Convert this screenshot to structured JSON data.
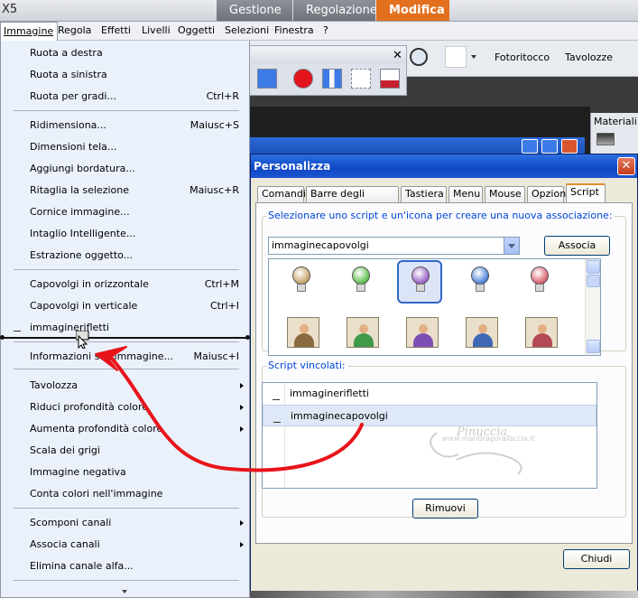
{
  "window": {
    "title_fragment": "X5"
  },
  "top_tabs": [
    {
      "label": "Gestione"
    },
    {
      "label": "Regolazione"
    },
    {
      "label": "Modifica",
      "active": true
    }
  ],
  "menubar": [
    {
      "label": "Immagine"
    },
    {
      "label": "Regola"
    },
    {
      "label": "Effetti"
    },
    {
      "label": "Livelli"
    },
    {
      "label": "Oggetti"
    },
    {
      "label": "Selezioni"
    },
    {
      "label": "Finestra"
    },
    {
      "label": "?"
    }
  ],
  "toolbar": {
    "fotoritocco": "Fotoritocco",
    "tavolozze": "Tavolozze"
  },
  "materiali": {
    "title": "Materiali"
  },
  "menu": {
    "items": [
      {
        "label": "Ruota a destra",
        "shortcut": ""
      },
      {
        "label": "Ruota a sinistra",
        "shortcut": ""
      },
      {
        "label": "Ruota per gradi...",
        "shortcut": "Ctrl+R"
      },
      {
        "label": "Ridimensiona...",
        "shortcut": "Maiusc+S"
      },
      {
        "label": "Dimensioni tela...",
        "shortcut": ""
      },
      {
        "label": "Aggiungi bordatura...",
        "shortcut": ""
      },
      {
        "label": "Ritaglia la selezione",
        "shortcut": "Maiusc+R"
      },
      {
        "label": "Cornice immagine...",
        "shortcut": ""
      },
      {
        "label": "Intaglio Intelligente...",
        "shortcut": ""
      },
      {
        "label": "Estrazione oggetto...",
        "shortcut": ""
      },
      {
        "label": "Capovolgi in orizzontale",
        "shortcut": "Ctrl+M"
      },
      {
        "label": "Capovolgi in verticale",
        "shortcut": "Ctrl+I"
      },
      {
        "label": "immaginerifletti",
        "shortcut": ""
      },
      {
        "label": "Informazioni sull'immagine...",
        "shortcut": "Maiusc+I"
      },
      {
        "label": "Tavolozza",
        "shortcut": ""
      },
      {
        "label": "Riduci profondità colore",
        "shortcut": ""
      },
      {
        "label": "Aumenta profondità colore",
        "shortcut": ""
      },
      {
        "label": "Scala dei grigi",
        "shortcut": ""
      },
      {
        "label": "Immagine negativa",
        "shortcut": ""
      },
      {
        "label": "Conta colori nell'immagine",
        "shortcut": ""
      },
      {
        "label": "Scomponi canali",
        "shortcut": ""
      },
      {
        "label": "Associa canali",
        "shortcut": ""
      },
      {
        "label": "Elimina canale alfa...",
        "shortcut": ""
      }
    ]
  },
  "dialog": {
    "title": "Personalizza",
    "tabs": [
      {
        "label": "Comandi"
      },
      {
        "label": "Barre degli strumenti"
      },
      {
        "label": "Tastiera"
      },
      {
        "label": "Menu"
      },
      {
        "label": "Mouse"
      },
      {
        "label": "Opzioni"
      },
      {
        "label": "Script",
        "active": true
      }
    ],
    "select_group_label": "Selezionare uno script e un'icona per creare una nuova associazione:",
    "script_combo_value": "immaginecapovolgi",
    "associa_button": "Associa",
    "bound_group_label": "Script vincolati:",
    "bound_scripts": [
      {
        "label": "immaginerifletti"
      },
      {
        "label": "immaginecapovolgi",
        "selected": true
      }
    ],
    "rimuovi_button": "Rimuovi",
    "chiudi_button": "Chiudi",
    "bulb_colors": [
      "#c8a36a",
      "#5fbf4b",
      "#9a63c9",
      "#4b84d6",
      "#d8626e"
    ],
    "person_colors": [
      "#8a6a3f",
      "#3f9a4a",
      "#7d4fb4",
      "#3f68b4",
      "#b44a55"
    ]
  },
  "watermark": {
    "name": "Pinuccia",
    "sub": "www.mandragorafaccia.it"
  },
  "colors": {
    "accent_tab": "#e2701f",
    "annotation_arrow": "#e8141a"
  }
}
